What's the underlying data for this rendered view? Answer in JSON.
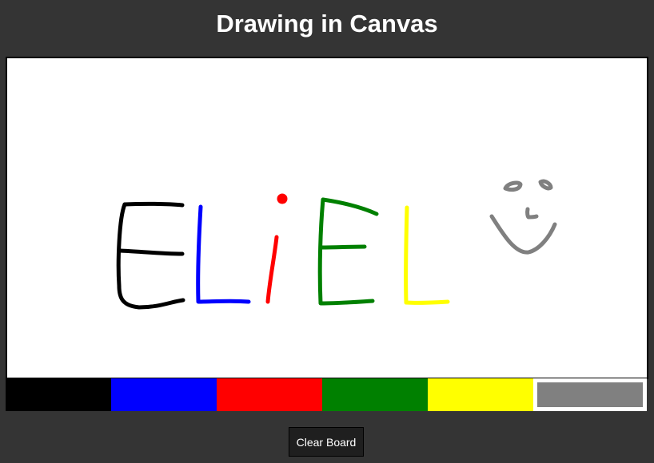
{
  "header": {
    "title": "Drawing in Canvas"
  },
  "palette": {
    "colors": [
      {
        "name": "black",
        "hex": "#000000"
      },
      {
        "name": "blue",
        "hex": "#0000ff"
      },
      {
        "name": "red",
        "hex": "#ff0000"
      },
      {
        "name": "green",
        "hex": "#008000"
      },
      {
        "name": "yellow",
        "hex": "#ffff00"
      },
      {
        "name": "gray",
        "hex": "#808080"
      }
    ],
    "selected": "gray"
  },
  "controls": {
    "clear_label": "Clear Board"
  }
}
